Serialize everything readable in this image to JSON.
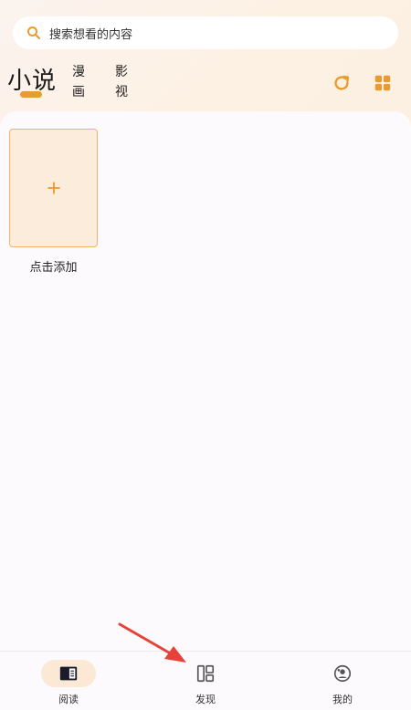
{
  "search": {
    "placeholder": "搜索想看的内容",
    "icon": "search-icon"
  },
  "tabs": {
    "active": "小说",
    "items": [
      "漫画",
      "影视"
    ]
  },
  "toolbar": {
    "refresh_icon": "refresh-icon",
    "grid_icon": "grid-icon"
  },
  "shelf": {
    "add_label": "点击添加",
    "add_icon": "plus-icon"
  },
  "bottom_nav": {
    "items": [
      {
        "label": "阅读",
        "icon": "book-icon",
        "active": true
      },
      {
        "label": "发现",
        "icon": "discover-icon",
        "active": false
      },
      {
        "label": "我的",
        "icon": "profile-icon",
        "active": false
      }
    ]
  },
  "colors": {
    "accent": "#e89b2f",
    "card_bg": "#fcecdc",
    "annotation_arrow": "#e8403a"
  }
}
